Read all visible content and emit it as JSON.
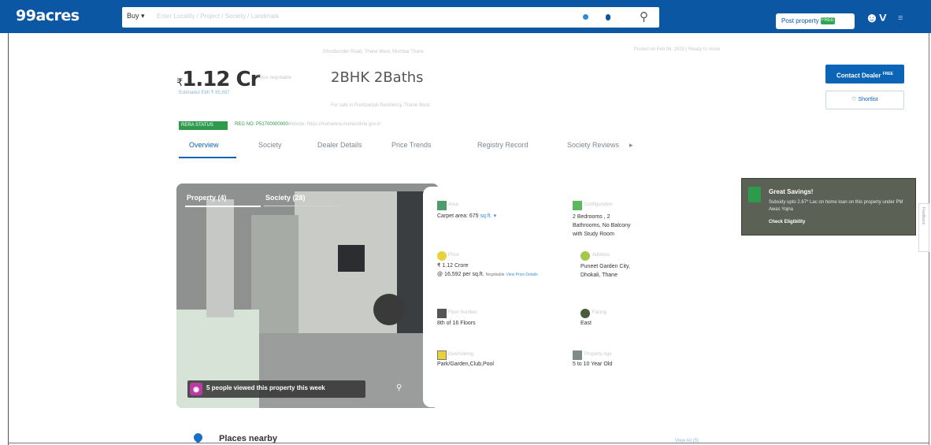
{
  "header": {
    "logo": "99acres",
    "buy_label": "Buy ▾",
    "search_placeholder": "Enter Locality / Project / Society / Landmark",
    "post_property": "Post property",
    "post_badge": "FREE",
    "user_icon": "user-icon",
    "menu_icon": "menu-icon"
  },
  "breadcrumb": {
    "center": "Ghodbunder Road, Thane West, Mumbai Thane",
    "right": "Posted on Feb 06, 2025  |  Ready to move"
  },
  "listing": {
    "price_symbol": "₹",
    "price": "1.12 Cr",
    "price_sub": "Price negotiable",
    "emi": "Estimated EMI ₹ 85,657",
    "config": "2BHK 2Baths",
    "config_sub": "For sale in Pushpanjali Residency, Thane West",
    "rera_badge": "RERA STATUS",
    "rera_no": "REG NO: P51700000000",
    "rera_web": "Website: https://maharera.mahaonline.gov.in"
  },
  "actions": {
    "contact": "Contact Dealer",
    "contact_badge": "FREE",
    "shortlist": "♡  Shortlist"
  },
  "tabs": [
    {
      "label": "Overview",
      "active": true
    },
    {
      "label": "Society",
      "active": false
    },
    {
      "label": "Dealer Details",
      "active": false
    },
    {
      "label": "Price Trends",
      "active": false
    },
    {
      "label": "Registry Record",
      "active": false
    },
    {
      "label": "Society Reviews",
      "active": false
    }
  ],
  "tabs_more": "▸",
  "gallery": {
    "tab_property": "Property (4)",
    "tab_society": "Society (28)",
    "viewed": "5 people viewed this property this week"
  },
  "specs": {
    "area_label": "Area",
    "area_val": "Carpet area: 675",
    "area_unit": "sq.ft. ▾",
    "config_label": "Configuration",
    "config_val": "2 Bedrooms , 2 Bathrooms, No Balcony with Study Room",
    "price_label": "Price",
    "price_val": "₹ 1.12 Crore",
    "price_per": "@ 16,592 per sq.ft.",
    "price_extra": "Negotiable",
    "price_link": "View Price Details",
    "address_label": "Address",
    "address_val": "Puneet Garden City, Dhokali, Thane",
    "floor_label": "Floor Number",
    "floor_val": "8th  of 16 Floors",
    "facing_label": "Facing",
    "facing_val": "East",
    "overlooking_label": "Overlooking",
    "overlooking_val": "Park/Garden,Club,Pool",
    "age_label": "Property Age",
    "age_val": "5 to 10 Year Old"
  },
  "savings": {
    "title": "Great Savings!",
    "text": "Subsidy upto 2.67* Lac on home loan on this property under PM Awas Yojna",
    "link": "Check Eligibility"
  },
  "feedback": "Feedback",
  "places": {
    "title": "Places nearby",
    "view_all": "View All (5)"
  },
  "colors": {
    "brand": "#0b57a4",
    "accent": "#0b64b5",
    "rera_green": "#2f9a4b",
    "savings_bg": "#5c6156"
  }
}
